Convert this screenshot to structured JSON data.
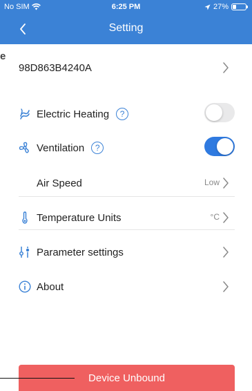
{
  "status": {
    "carrier": "No SIM",
    "time": "6:25 PM",
    "battery": "27%",
    "battery_level": 0.27
  },
  "nav": {
    "title": "Setting"
  },
  "edge_text": "e",
  "device": {
    "id": "98D863B4240A"
  },
  "items": {
    "heating": {
      "label": "Electric Heating",
      "help": "?",
      "enabled": false
    },
    "ventilation": {
      "label": "Ventilation",
      "help": "?",
      "enabled": true
    },
    "air_speed": {
      "label": "Air Speed",
      "value": "Low"
    },
    "temp_units": {
      "label": "Temperature Units",
      "value": "°C"
    },
    "params": {
      "label": "Parameter settings"
    },
    "about": {
      "label": "About"
    }
  },
  "actions": {
    "unbind": "Device Unbound"
  },
  "colors": {
    "header": "#3b82d6",
    "accent": "#2f7ae0",
    "danger": "#ef6060"
  }
}
